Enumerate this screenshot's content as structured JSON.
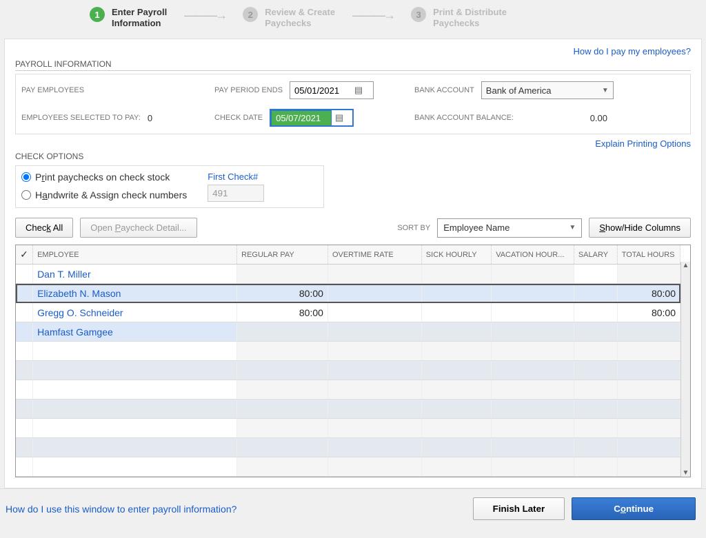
{
  "steps": {
    "s1": {
      "num": "1",
      "label_l1": "Enter Payroll",
      "label_l2": "Information"
    },
    "s2": {
      "num": "2",
      "label_l1": "Review & Create",
      "label_l2": "Paychecks"
    },
    "s3": {
      "num": "3",
      "label_l1": "Print & Distribute",
      "label_l2": "Paychecks"
    }
  },
  "help": {
    "top": "How do I pay my employees?"
  },
  "payroll_info": {
    "title": "PAYROLL INFORMATION",
    "pay_employees_label": "PAY EMPLOYEES",
    "employees_selected_label": "EMPLOYEES SELECTED TO PAY:",
    "employees_selected_value": "0",
    "pay_period_ends_label": "PAY PERIOD ENDS",
    "pay_period_ends_value": "05/01/2021",
    "check_date_label": "CHECK DATE",
    "check_date_value": "05/07/2021",
    "bank_account_label": "BANK ACCOUNT",
    "bank_account_value": "Bank of America",
    "bank_balance_label": "BANK ACCOUNT BALANCE:",
    "bank_balance_value": "0.00"
  },
  "check_options": {
    "title": "CHECK OPTIONS",
    "r1_pre": "P",
    "r1_mid": "r",
    "r1_post": "int paychecks on check stock",
    "r2_pre": "H",
    "r2_mid": "a",
    "r2_post": "ndwrite & Assign check numbers",
    "first_check_label": "First Check#",
    "first_check_value": "491"
  },
  "toolbar": {
    "check_all_pre": "Chec",
    "check_all_mid": "k",
    "check_all_post": " All",
    "open_detail_pre": "Open ",
    "open_detail_mid": "P",
    "open_detail_post": "aycheck Detail...",
    "sort_by_label": "SORT BY",
    "sort_by_value": "Employee Name",
    "show_hide_pre": "",
    "show_hide_mid": "S",
    "show_hide_post": "how/Hide Columns"
  },
  "explain_link": "Explain Printing Options",
  "table": {
    "cols": {
      "check": "✓",
      "employee": "EMPLOYEE",
      "regular": "REGULAR PAY",
      "overtime": "OVERTIME RATE",
      "sick": "SICK HOURLY",
      "vacation": "VACATION HOUR...",
      "salary": "SALARY",
      "total": "TOTAL HOURS"
    },
    "rows": [
      {
        "name": "Dan T. Miller",
        "regular": "",
        "total": ""
      },
      {
        "name": "Elizabeth N. Mason",
        "regular": "80:00",
        "total": "80:00"
      },
      {
        "name": "Gregg O. Schneider",
        "regular": "80:00",
        "total": "80:00"
      },
      {
        "name": "Hamfast Gamgee",
        "regular": "",
        "total": ""
      }
    ]
  },
  "footer": {
    "help": "How do I use this window to enter payroll information?",
    "finish": "Finish Later",
    "cont_pre": "C",
    "cont_mid": "o",
    "cont_post": "ntinue"
  }
}
